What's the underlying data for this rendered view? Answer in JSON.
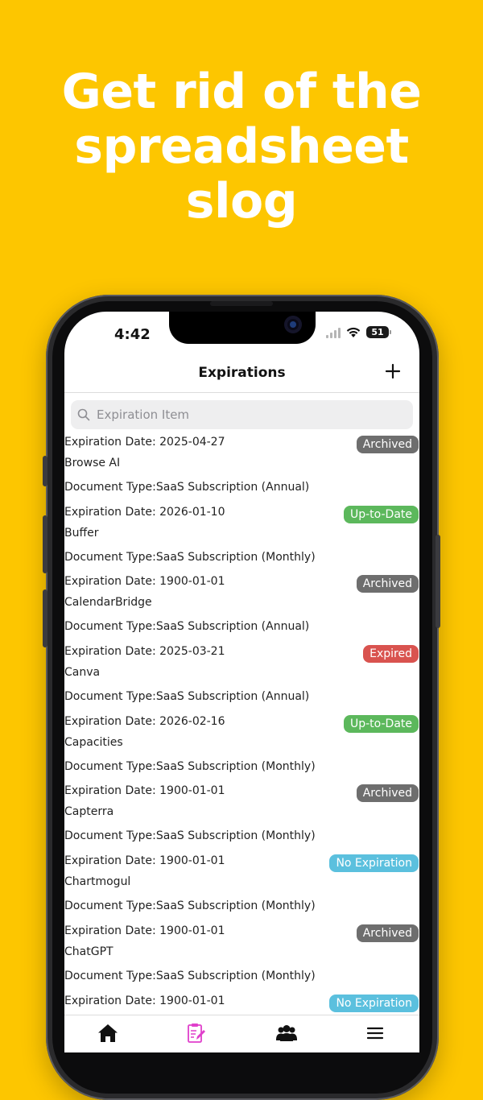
{
  "headline": {
    "lines": [
      "Get rid of the",
      "spreadsheet",
      "slog"
    ]
  },
  "status_bar": {
    "time": "4:42",
    "battery": "51"
  },
  "nav": {
    "title": "Expirations",
    "add_icon": "plus-icon"
  },
  "search": {
    "placeholder": "Expiration Item",
    "value": "",
    "icon": "search-icon"
  },
  "items": [
    {
      "date_label": "Expiration Date: 2025-04-27",
      "name": "Browse AI",
      "doc_type": "Document Type:SaaS Subscription (Annual)",
      "status": "Archived",
      "status_color": "#6E6E6E"
    },
    {
      "date_label": "Expiration Date: 2026-01-10",
      "name": "Buffer",
      "doc_type": "Document Type:SaaS Subscription (Monthly)",
      "status": "Up-to-Date",
      "status_color": "#5CB85C"
    },
    {
      "date_label": "Expiration Date: 1900-01-01",
      "name": "CalendarBridge",
      "doc_type": "Document Type:SaaS Subscription (Annual)",
      "status": "Archived",
      "status_color": "#6E6E6E"
    },
    {
      "date_label": "Expiration Date: 2025-03-21",
      "name": "Canva",
      "doc_type": "Document Type:SaaS Subscription (Annual)",
      "status": "Expired",
      "status_color": "#D9534F"
    },
    {
      "date_label": "Expiration Date: 2026-02-16",
      "name": "Capacities",
      "doc_type": "Document Type:SaaS Subscription (Monthly)",
      "status": "Up-to-Date",
      "status_color": "#5CB85C"
    },
    {
      "date_label": "Expiration Date: 1900-01-01",
      "name": "Capterra",
      "doc_type": "Document Type:SaaS Subscription (Monthly)",
      "status": "Archived",
      "status_color": "#6E6E6E"
    },
    {
      "date_label": "Expiration Date: 1900-01-01",
      "name": "Chartmogul",
      "doc_type": "Document Type:SaaS Subscription (Monthly)",
      "status": "No Expiration",
      "status_color": "#5BC0DE"
    },
    {
      "date_label": "Expiration Date: 1900-01-01",
      "name": "ChatGPT",
      "doc_type": "Document Type:SaaS Subscription (Monthly)",
      "status": "Archived",
      "status_color": "#6E6E6E"
    },
    {
      "date_label": "Expiration Date: 1900-01-01",
      "name": "",
      "doc_type": "",
      "status": "No Expiration",
      "status_color": "#5BC0DE"
    }
  ],
  "tabs": [
    {
      "icon": "home-icon",
      "active": false
    },
    {
      "icon": "document-edit-icon",
      "active": true
    },
    {
      "icon": "people-icon",
      "active": false
    },
    {
      "icon": "menu-icon",
      "active": false
    }
  ],
  "colors": {
    "background": "#FDC600",
    "accent": "#E03FCB"
  }
}
